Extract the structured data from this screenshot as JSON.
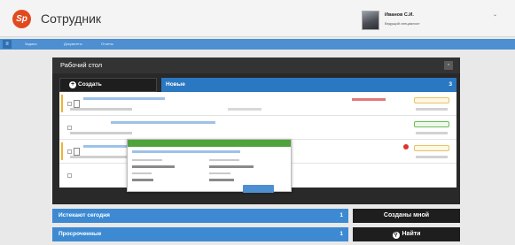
{
  "header": {
    "logo_text": "Sp",
    "app_title": "Сотрудник",
    "user_name": "Иванов С.И.",
    "user_role": "Ведущий специалист",
    "caret": "⌄"
  },
  "menu": {
    "menu_icon": "menu-icon",
    "items": [
      "Задачи",
      "Документы",
      "Отчеты"
    ]
  },
  "desktop": {
    "title": "Рабочий стол",
    "close": "▫",
    "create_label": "Создать",
    "create_icon": "+",
    "new_label": "Новые",
    "new_count": "3"
  },
  "tiles": {
    "expiring_label": "Истекают сегодня",
    "expiring_count": "1",
    "overdue_label": "Просроченные",
    "overdue_count": "1",
    "created_by_me_label": "Созданы мной",
    "find_label": "Найти",
    "find_icon": "search-icon"
  },
  "colors": {
    "brand_red": "#e14a1f",
    "accent_blue": "#2b78c2",
    "menu_blue": "#4d8fd1",
    "dark_panel": "#292929",
    "popup_green": "#4fa23c",
    "flag_orange": "#f0b23a",
    "alert_red": "#d9362f"
  }
}
